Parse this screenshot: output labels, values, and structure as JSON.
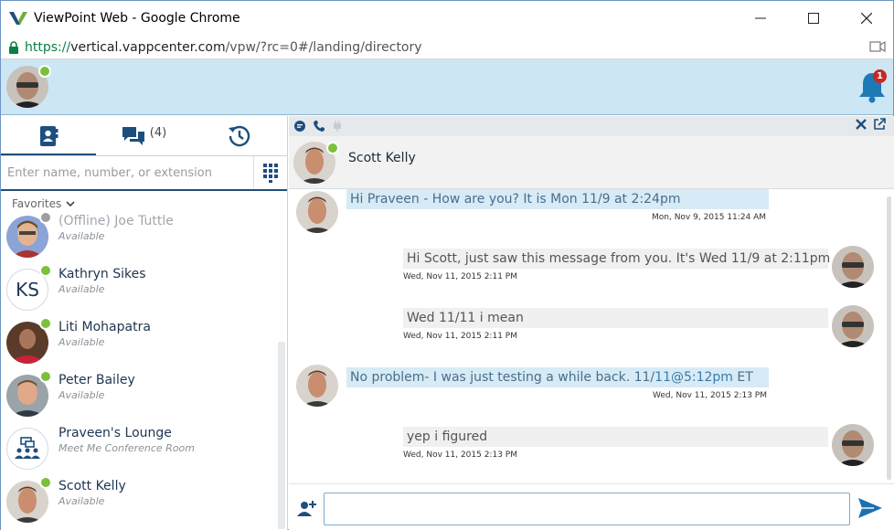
{
  "window": {
    "title": "ViewPoint Web - Google Chrome",
    "url_scheme": "https://",
    "url_host": "vertical.vappcenter.com",
    "url_path": "/vpw/?rc=0#/landing/directory"
  },
  "header": {
    "notification_count": "1"
  },
  "left_panel": {
    "tabs": [
      {
        "label": "contacts"
      },
      {
        "label": "chats",
        "count": "(4)"
      },
      {
        "label": "history"
      }
    ],
    "search_placeholder": "Enter name, number, or extension",
    "favorites_label": "Favorites",
    "contacts": [
      {
        "name": "(Offline) Joe Tuttle",
        "status": "Available",
        "presence": "offline"
      },
      {
        "name": "Kathryn Sikes",
        "status": "Available",
        "initials": "KS",
        "presence": "online"
      },
      {
        "name": "Liti Mohapatra",
        "status": "Available",
        "presence": "online"
      },
      {
        "name": "Peter Bailey",
        "status": "Available",
        "presence": "online"
      },
      {
        "name": "Praveen's Lounge",
        "status": "Meet Me Conference Room"
      },
      {
        "name": "Scott Kelly",
        "status": "Available",
        "presence": "online"
      }
    ]
  },
  "chat": {
    "contact_name": "Scott Kelly",
    "messages": [
      {
        "dir": "in",
        "text": "Hi Praveen - How are you? It is Mon 11/9 at 2:24pm",
        "time": "Mon, Nov 9, 2015 11:24 AM"
      },
      {
        "dir": "out",
        "text": "Hi Scott, just saw this message from you. It's Wed 11/9 at 2:11pm :)",
        "time": "Wed, Nov 11, 2015 2:11 PM"
      },
      {
        "dir": "out",
        "text": "Wed 11/11 i mean",
        "time": "Wed, Nov 11, 2015 2:11 PM"
      },
      {
        "dir": "in",
        "text_a": "No problem- I was just testing a while back. 11/",
        "text_b": "11@5:12pm",
        "text_c": " ET",
        "time": "Wed, Nov 11, 2015 2:13 PM"
      },
      {
        "dir": "out",
        "text": "yep i figured",
        "time": "Wed, Nov 11, 2015 2:13 PM"
      }
    ],
    "compose_value": ""
  },
  "colors": {
    "header_bg": "#cde6f3",
    "accent": "#1f4e7a",
    "presence_online": "#7bbf3a",
    "badge": "#c62828"
  }
}
